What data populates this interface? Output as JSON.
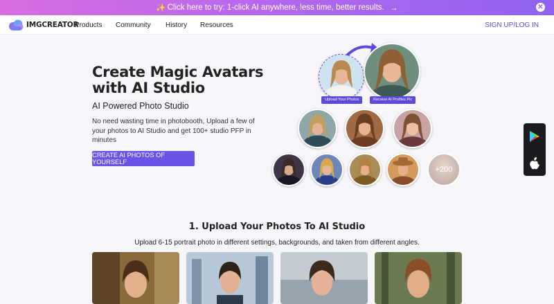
{
  "promo": {
    "text": "Click here to try: 1-click AI anywhere, less time, better results.",
    "icon": "sparkles-icon"
  },
  "nav": {
    "logo_text": "IMGCREATOR",
    "items": [
      "Products",
      "Community",
      "History",
      "Resources"
    ],
    "signup": "SIGN UP/LOG IN"
  },
  "hero": {
    "title": "Create Magic Avatars with AI Studio",
    "subtitle": "AI Powered Photo Studio",
    "description": "No need wasting time in photobooth, Upload a few of your photos to AI Studio and get 100+ studio PFP in minutes",
    "cta": "CREATE AI PHOTOS OF YOURSELF"
  },
  "showcase": {
    "upload_label": "Upload Your Photos",
    "receive_label": "Receive AI Profiles Pic",
    "more_count": "+200"
  },
  "colors": {
    "accent": "#6a53e5",
    "promo_start": "#d86ce0",
    "promo_end": "#8f63ef",
    "link": "#5a4fe0"
  },
  "section": {
    "title": "1. Upload Your Photos To AI Studio",
    "description": "Upload 6-15 portrait photo in different settings, backgrounds, and taken from different angles."
  },
  "store_badges": [
    "google-play-icon",
    "apple-icon"
  ]
}
